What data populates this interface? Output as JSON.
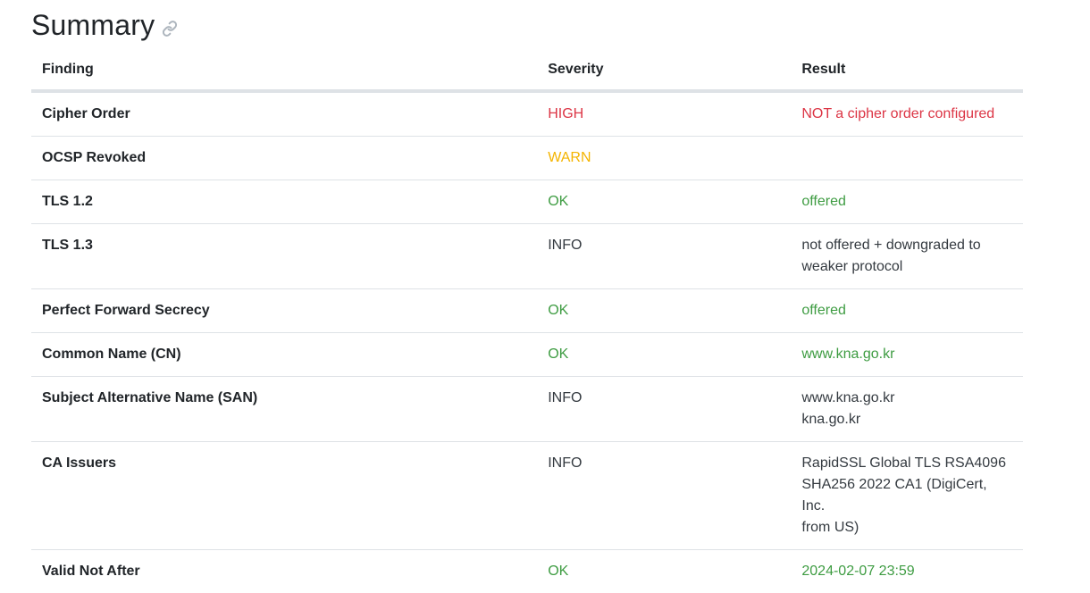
{
  "heading": {
    "title": "Summary"
  },
  "table": {
    "headers": {
      "finding": "Finding",
      "severity": "Severity",
      "result": "Result"
    },
    "rows": [
      {
        "finding": "Cipher Order",
        "severity": "HIGH",
        "result": [
          "NOT a cipher order configured"
        ]
      },
      {
        "finding": "OCSP Revoked",
        "severity": "WARN",
        "result": []
      },
      {
        "finding": "TLS 1.2",
        "severity": "OK",
        "result": [
          "offered"
        ]
      },
      {
        "finding": "TLS 1.3",
        "severity": "INFO",
        "result": [
          "not offered + downgraded to",
          "weaker protocol"
        ]
      },
      {
        "finding": "Perfect Forward Secrecy",
        "severity": "OK",
        "result": [
          "offered"
        ]
      },
      {
        "finding": "Common Name (CN)",
        "severity": "OK",
        "result": [
          "www.kna.go.kr"
        ]
      },
      {
        "finding": "Subject Alternative Name (SAN)",
        "severity": "INFO",
        "result": [
          "www.kna.go.kr",
          "kna.go.kr"
        ]
      },
      {
        "finding": "CA Issuers",
        "severity": "INFO",
        "result": [
          "RapidSSL Global TLS RSA4096",
          "SHA256 2022 CA1 (DigiCert, Inc.",
          "from US)"
        ]
      },
      {
        "finding": "Valid Not After",
        "severity": "OK",
        "result": [
          "2024-02-07 23:59"
        ]
      }
    ]
  },
  "colors": {
    "HIGH": "#dc3545",
    "WARN": "#f4b400",
    "OK": "#3e9c42",
    "INFO": "#343a40",
    "link_icon": "#adb5bd"
  },
  "icons": {
    "heading_link": "link-icon"
  }
}
